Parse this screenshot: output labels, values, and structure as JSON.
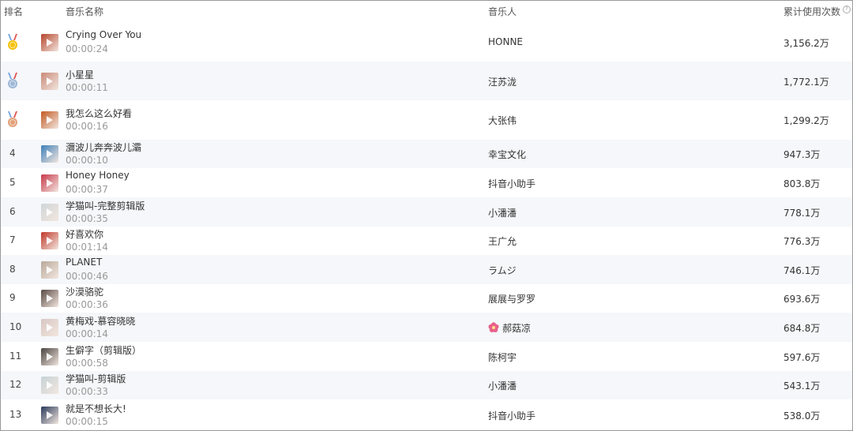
{
  "header": {
    "rank": "排名",
    "title": "音乐名称",
    "artist": "音乐人",
    "count": "累计使用次数",
    "help_glyph": "?"
  },
  "rows": [
    {
      "rank": "1",
      "medal": "gold",
      "title": "Crying Over You",
      "duration": "00:00:24",
      "artist": "HONNE",
      "count": "3,156.2万",
      "cover": "#b5452b"
    },
    {
      "rank": "2",
      "medal": "silver",
      "title": "小星星",
      "duration": "00:00:11",
      "artist": "汪苏泷",
      "count": "1,772.1万",
      "cover": "#c98a7a"
    },
    {
      "rank": "3",
      "medal": "bronze",
      "title": "我怎么这么好看",
      "duration": "00:00:16",
      "artist": "大张伟",
      "count": "1,299.2万",
      "cover": "#c25a22"
    },
    {
      "rank": "4",
      "title": "瀰波儿奔奔波儿灞",
      "duration": "00:00:10",
      "artist": "幸宝文化",
      "count": "947.3万",
      "cover": "#3d7fb8"
    },
    {
      "rank": "5",
      "title": "Honey Honey",
      "duration": "00:00:37",
      "artist": "抖音小助手",
      "count": "803.8万",
      "cover": "#c8384a"
    },
    {
      "rank": "6",
      "title": "学猫叫-完整剪辑版",
      "duration": "00:00:35",
      "artist": "小潘潘",
      "count": "778.1万",
      "cover": "#cfd6d8"
    },
    {
      "rank": "7",
      "title": "好喜欢你",
      "duration": "00:01:14",
      "artist": "王广允",
      "count": "776.3万",
      "cover": "#c0392b"
    },
    {
      "rank": "8",
      "title": "PLANET",
      "duration": "00:00:46",
      "artist": "ラムジ",
      "count": "746.1万",
      "cover": "#b8a99a"
    },
    {
      "rank": "9",
      "title": "沙漠骆驼",
      "duration": "00:00:36",
      "artist": "展展与罗罗",
      "count": "693.6万",
      "cover": "#5a4a44"
    },
    {
      "rank": "10",
      "title": "黄梅戏-慕容晓晓",
      "duration": "00:00:14",
      "artist": "郝菇凉",
      "count": "684.8万",
      "cover": "#d8c6c2",
      "artist_icon": true
    },
    {
      "rank": "11",
      "title": "生僻字（剪辑版）",
      "duration": "00:00:58",
      "artist": "陈柯宇",
      "count": "597.6万",
      "cover": "#4a4440"
    },
    {
      "rank": "12",
      "title": "学猫叫-剪辑版",
      "duration": "00:00:33",
      "artist": "小潘潘",
      "count": "543.1万",
      "cover": "#c6d2d6"
    },
    {
      "rank": "13",
      "title": "就是不想长大!",
      "duration": "00:00:15",
      "artist": "抖音小助手",
      "count": "538.0万",
      "cover": "#2a3a5a"
    }
  ],
  "medal_colors": {
    "gold": "#f4c20d",
    "silver": "#9fb8d6",
    "bronze": "#e2a27a",
    "ribbon": "#7aa7e0"
  },
  "alt_row_color": "#f5f7fa",
  "flower_color": "#e8608a"
}
